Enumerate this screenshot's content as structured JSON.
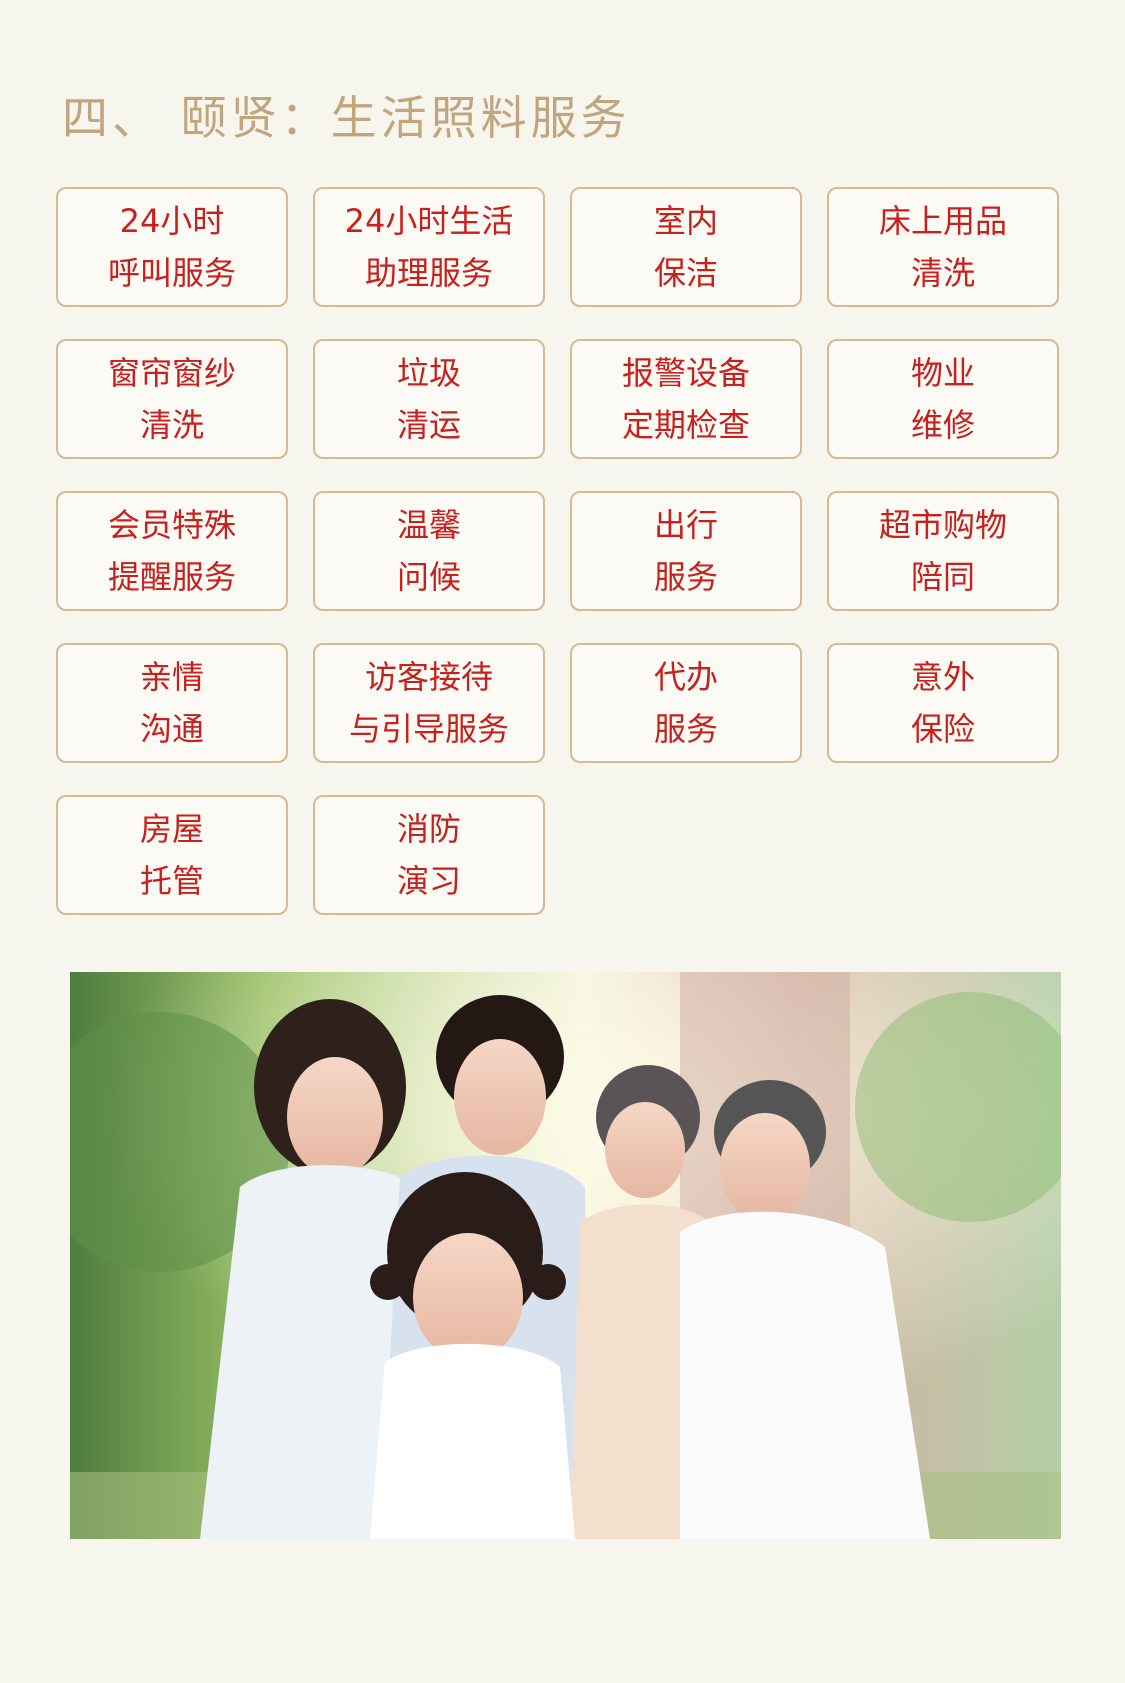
{
  "title": "四、 颐贤：生活照料服务",
  "services": [
    [
      "24小时",
      "呼叫服务"
    ],
    [
      "24小时生活",
      "助理服务"
    ],
    [
      "室内",
      "保洁"
    ],
    [
      "床上用品",
      "清洗"
    ],
    [
      "窗帘窗纱",
      "清洗"
    ],
    [
      "垃圾",
      "清运"
    ],
    [
      "报警设备",
      "定期检查"
    ],
    [
      "物业",
      "维修"
    ],
    [
      "会员特殊",
      "提醒服务"
    ],
    [
      "温馨",
      "问候"
    ],
    [
      "出行",
      "服务"
    ],
    [
      "超市购物",
      "陪同"
    ],
    [
      "亲情",
      "沟通"
    ],
    [
      "访客接待",
      "与引导服务"
    ],
    [
      "代办",
      "服务"
    ],
    [
      "意外",
      "保险"
    ],
    [
      "房屋",
      "托管"
    ],
    [
      "消防",
      "演习"
    ]
  ],
  "colors": {
    "background": "#f6f5ee",
    "title": "#c2a57d",
    "card_border": "#d8b990",
    "card_text": "#c8201c"
  }
}
